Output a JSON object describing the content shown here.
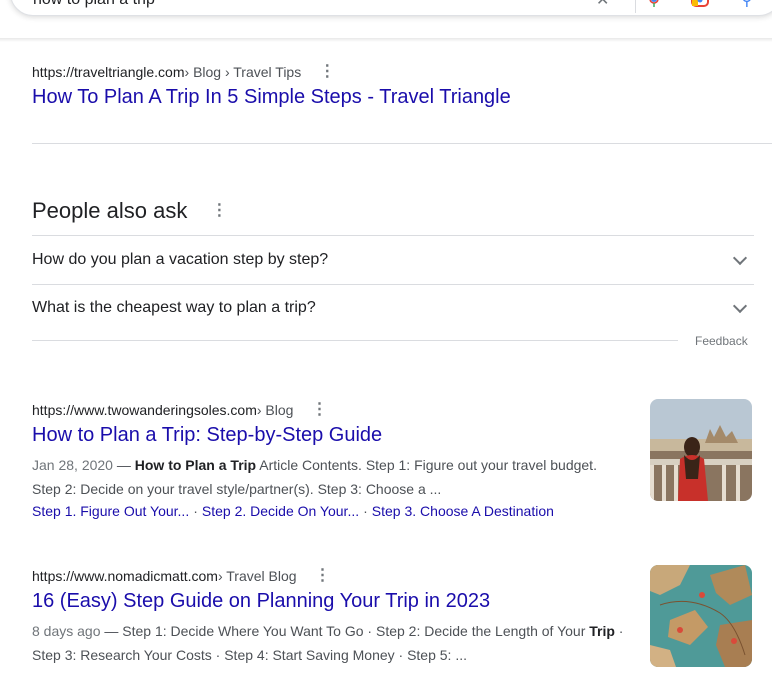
{
  "search": {
    "query": "how to plan a trip",
    "clear_icon": "close-icon",
    "mic_icon": "microphone-icon",
    "lens_icon": "google-lens-icon",
    "search_icon": "search-icon"
  },
  "results": [
    {
      "site": "https://traveltriangle.com",
      "path": " › Blog › Travel Tips",
      "title": "How To Plan A Trip In 5 Simple Steps - Travel Triangle"
    },
    {
      "site": "https://www.twowanderingsoles.com",
      "path": " › Blog",
      "title": "How to Plan a Trip: Step-by-Step Guide",
      "date": "Jan 28, 2020",
      "bold": "How to Plan a Trip",
      "snippet_rest": " Article Contents. Step 1: Figure out your travel budget. Step 2: Decide on your travel style/partner(s). Step 3: Choose a ...",
      "sitelinks": [
        "Step 1. Figure Out Your...",
        "Step 2. Decide On Your...",
        "Step 3. Choose A Destination"
      ]
    },
    {
      "site": "https://www.nomadicmatt.com",
      "path": " › Travel Blog",
      "title": "16 (Easy) Step Guide on Planning Your Trip in 2023",
      "date": "8 days ago",
      "snippet_pre": " Step 1: Decide Where You Want To Go · Step 2: Decide the Length of Your ",
      "bold": "Trip",
      "snippet_rest": " · Step 3: Research Your Costs · Step 4: Start Saving Money · Step 5: ..."
    }
  ],
  "people_also_ask": {
    "heading": "People also ask",
    "questions": [
      "How do you plan a vacation step by step?",
      "What is the cheapest way to plan a trip?"
    ],
    "feedback": "Feedback"
  },
  "separator": "—",
  "sitelink_separator": "·",
  "colors": {
    "link": "#1a0dab",
    "text": "#202124",
    "muted": "#4d5156",
    "divider": "#dadce0"
  }
}
